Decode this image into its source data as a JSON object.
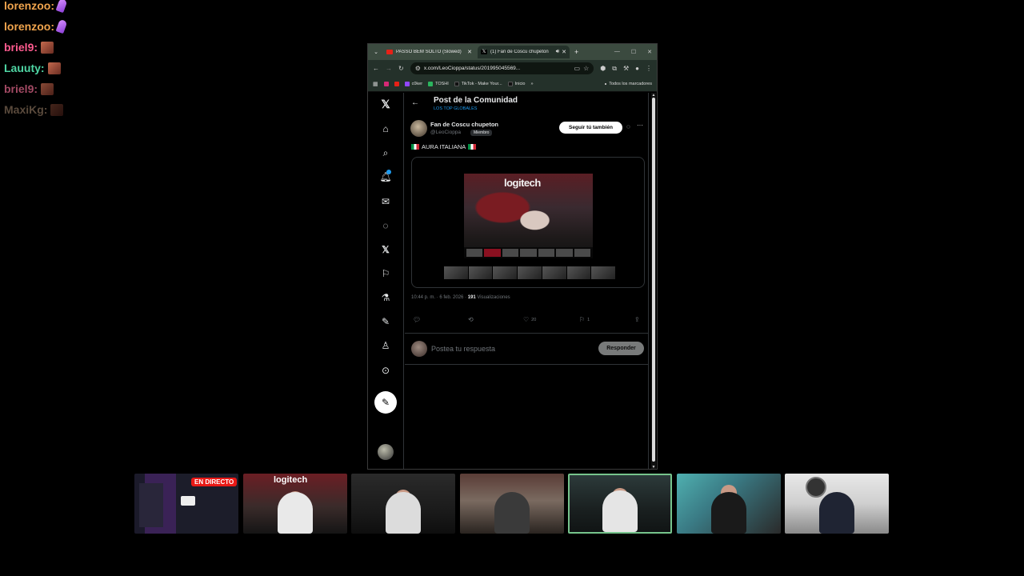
{
  "chat": {
    "messages": [
      {
        "user": "lorenzoo:",
        "color": "#f0a44d",
        "emote": "feather"
      },
      {
        "user": "lorenzoo:",
        "color": "#f0a44d",
        "emote": "feather"
      },
      {
        "user": "briel9:",
        "color": "#ff5b8f",
        "emote": "face"
      },
      {
        "user": "Lauuty:",
        "color": "#4fd6a4",
        "emote": "face"
      },
      {
        "user": "briel9:",
        "color": "#a34a64",
        "emote": "face"
      },
      {
        "user": "MaxiKg:",
        "color": "#5a4a3c",
        "emote": "face"
      }
    ]
  },
  "browser": {
    "tabs": [
      {
        "title": "PASSO BEM SOLTO (Slowed)",
        "active": false
      },
      {
        "title": "(1) Fan de Coscu chupeton",
        "active": true
      }
    ],
    "url": "x.com/LeoCioppa/status/201995045569...",
    "bookmarks": [
      "c0ker",
      "TOSHI",
      "TikTok - Make Your...",
      "Inicio"
    ],
    "bookmarks_right": "Todos los marcadores"
  },
  "x": {
    "header": {
      "title": "Post de la Comunidad",
      "subtitle": "LOS TOP GLOBALES"
    },
    "post": {
      "name": "Fan de Coscu chupeton",
      "handle": "@LeoCioppa",
      "member_badge": "Miembro",
      "follow_label": "Seguir tú también",
      "text": "AURA ITALIANA",
      "video_logo": "logitech",
      "time": "10:44 p. m. · 6 feb. 2026 ·",
      "views_count": "191",
      "views_label": "Visualizaciones",
      "likes": "20",
      "bookmarks": "1"
    },
    "reply": {
      "placeholder": "Postea tu respuesta",
      "button": "Responder"
    }
  },
  "cams": {
    "live_label": "EN DIRECTO",
    "video_logo": "logitech"
  }
}
